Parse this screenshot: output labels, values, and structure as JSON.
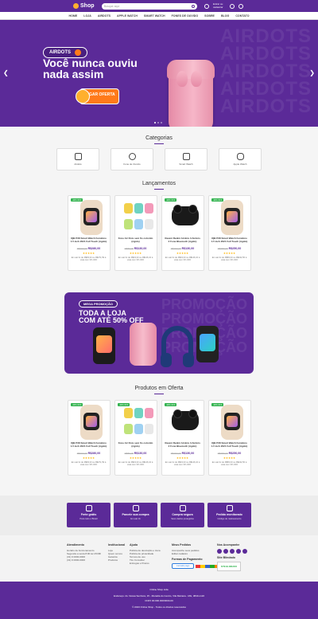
{
  "header": {
    "logo_text": "Shop",
    "search_placeholder": "Busque aqui",
    "account_text": "Entrar ou cadastrar",
    "cart_count": "0"
  },
  "nav": [
    "HOME",
    "LOJA",
    "AIRDOTS",
    "APPLE WATCH",
    "SMART WATCH",
    "FONES DE OUVIDO",
    "SOBRE",
    "BLOG",
    "CONTATO"
  ],
  "hero": {
    "badge": "AIRDOTS",
    "headline_line1": "Você nunca ouviu",
    "headline_line2": "nada assim",
    "cta": "PEGAR OFERTA",
    "bg_text": "AIRDOTS"
  },
  "categories": {
    "title": "Categorias",
    "items": [
      {
        "label": "Airdots",
        "icon": "earbuds-icon"
      },
      {
        "label": "Fone de Ouvido",
        "icon": "headphones-icon"
      },
      {
        "label": "Smart Watch",
        "icon": "watch-icon"
      },
      {
        "label": "Apple Watch",
        "icon": "apple-icon"
      }
    ]
  },
  "launches": {
    "title": "Lançamentos",
    "products": [
      {
        "tag": "-10% OFF",
        "name": "IQB P38 Smart Watch Feminino 1.5 inch 2021 Full Touch (rígido)",
        "old": "R$300,00",
        "price": "R$280,00",
        "stars": "★★★★★",
        "inst": "Em até 3x de R$93,33\nou R$271,59 à vista com 3% OFF"
      },
      {
        "tag": "",
        "name": "Fone Air Dots sem fio colorido (rígido)",
        "old": "R$80,00",
        "price": "R$130,00",
        "stars": "★★★★★",
        "inst": "Em até 3x de R$43,33\nou R$126,10 à vista com 3% OFF"
      },
      {
        "tag": "-10% OFF",
        "name": "Xiaomi Redmi Airdots 3 Airdots 2 Fone Bluetooth (rígido)",
        "old": "R$150,00",
        "price": "R$130,00",
        "stars": "★★★★★",
        "inst": "Em até 3x de R$43,33\nou R$126,10 à vista com 3% OFF"
      },
      {
        "tag": "-10% OFF",
        "name": "IQB P38 Smart Watch Feminino 1.5 inch 2021 Full Touch (rígido)",
        "old": "R$380,00",
        "price": "R$250,00",
        "stars": "★★★★★",
        "inst": "Em até 3x de R$83,33\nou R$242,50 à vista com 3% OFF"
      }
    ]
  },
  "promo": {
    "tag": "MEGA PROMOÇÃO",
    "line1": "TODA A LOJA",
    "line2": "COM ATÉ 50% OFF",
    "bg_text": "PROMOÇÃO"
  },
  "offers": {
    "title": "Produtos em Oferta",
    "products": [
      {
        "tag": "-10% OFF",
        "name": "IQB P38 Smart Watch Feminino 1.5 inch 2021 Full Touch (rígido)",
        "old": "R$300,00",
        "price": "R$280,00",
        "stars": "★★★★★",
        "inst": "Em até 3x de R$93,33\nou R$271,59 à vista com 3% OFF"
      },
      {
        "tag": "-10% OFF",
        "name": "Fone Air Dots sem fio colorido (rígido)",
        "old": "R$80,00",
        "price": "R$130,00",
        "stars": "★★★★★",
        "inst": "Em até 3x de R$43,33\nou R$126,10 à vista com 3% OFF"
      },
      {
        "tag": "-10% OFF",
        "name": "Xiaomi Redmi Airdots 3 Airdots 2 Fone Bluetooth (rígido)",
        "old": "R$150,00",
        "price": "R$130,00",
        "stars": "★★★★★",
        "inst": "Em até 3x de R$43,33\nou R$126,10 à vista com 3% OFF"
      },
      {
        "tag": "-10% OFF",
        "name": "IQB P38 Smart Watch Feminino 1.5 inch 2021 Full Touch (rígido)",
        "old": "R$380,00",
        "price": "R$250,00",
        "stars": "★★★★★",
        "inst": "Em até 3x de R$83,33\nou R$242,50 à vista com 3% OFF"
      }
    ]
  },
  "benefits": [
    {
      "title": "Frete grátis",
      "sub": "Para todo o Brasil",
      "icon": "truck-icon"
    },
    {
      "title": "Parcele sua compra",
      "sub": "Em até 3x",
      "icon": "card-icon"
    },
    {
      "title": "Compra segura",
      "sub": "Seus dados protegidos",
      "icon": "shield-icon"
    },
    {
      "title": "Pedido monitorado",
      "sub": "Código de rastreamento",
      "icon": "package-icon"
    }
  ],
  "footer": {
    "col1_title": "Atendimento",
    "col1_lines": [
      "Horário de funcionamento",
      "Segunda a sexta 8:00 às 18:00h",
      "(31) 9 0000-0000",
      "(31) 9 0000-0000"
    ],
    "col2_title": "Institucional",
    "col2_lines": [
      "Loja",
      "Quem somos",
      "Garantia",
      "Produtos"
    ],
    "col3_title": "Ajuda",
    "col3_lines": [
      "Política de devolução e troca",
      "Política de privacidade",
      "Termos de uso",
      "Tire Consultar",
      "Entregas e Prazos"
    ],
    "col4_title": "Meus Pedidos",
    "col4_lines": [
      "Acompanhe seus pedidos",
      "Editar cadastro"
    ],
    "payment_title": "Formas de Pagamento",
    "payment_brand": "mercado pago",
    "col5_title": "Nos Acompanhe",
    "seal_title": "Site Blindado",
    "seal_text": "SITE BLINDADO",
    "bottom_line1": "Online Shop Ltda",
    "bottom_line2": "Endereço: Av. Nossa Senhora, 15 - Moradia do Centro, Vila Mariana - MG, 38411-120",
    "bottom_line3": "CNPJ 00.000.000/0000-00",
    "bottom_line4": "© 2023 Online Shop - Todos os direitos reservados"
  },
  "colors": {
    "brand": "#5b2a98",
    "accent": "#ff7a1a",
    "success": "#2fb24c",
    "star": "#ffb400"
  }
}
